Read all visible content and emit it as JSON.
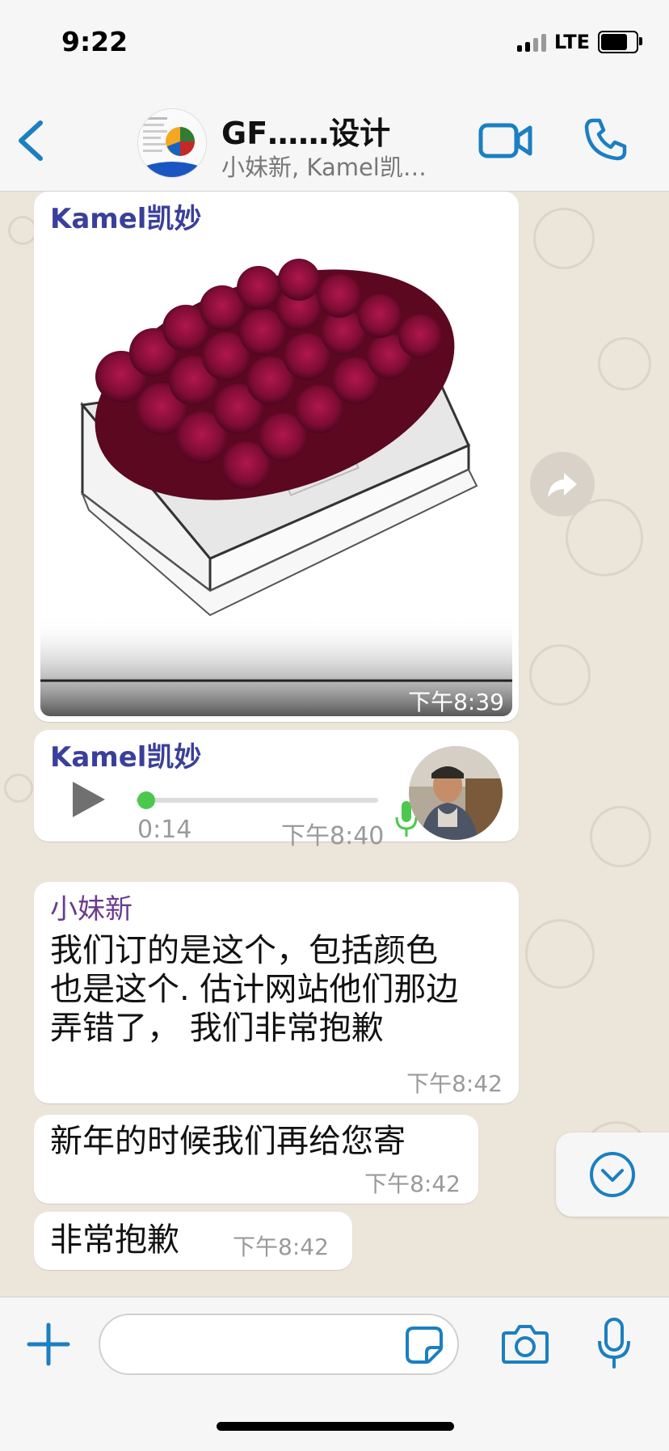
{
  "status_bar": {
    "time": "9:22",
    "network": "LTE"
  },
  "header": {
    "title": "GF……设计",
    "subtitle": "小妹新, Kamel凯…",
    "accent_color": "#1b7fc1"
  },
  "messages": [
    {
      "sender": "Kamel凯妙",
      "sender_color": "#3a3f9a",
      "kind": "image",
      "image_description_icon": "rose-box-photo",
      "time": "下午8:39"
    },
    {
      "sender": "Kamel凯妙",
      "sender_color": "#3a3f9a",
      "kind": "voice",
      "duration": "0:14",
      "progress": 0.0,
      "time": "下午8:40"
    },
    {
      "sender": "小妹新",
      "sender_color": "#6b3b8c",
      "kind": "text",
      "lines": [
        "我们订的是这个，包括颜色",
        "也是这个. 估计网站他们那边",
        "弄错了， 我们非常抱歉"
      ],
      "time": "下午8:42"
    },
    {
      "kind": "text",
      "lines": [
        "新年的时候我们再给您寄"
      ],
      "time": "下午8:42"
    },
    {
      "kind": "text",
      "lines": [
        "非常抱歉"
      ],
      "time": "下午8:42"
    }
  ],
  "composer": {
    "placeholder": ""
  }
}
